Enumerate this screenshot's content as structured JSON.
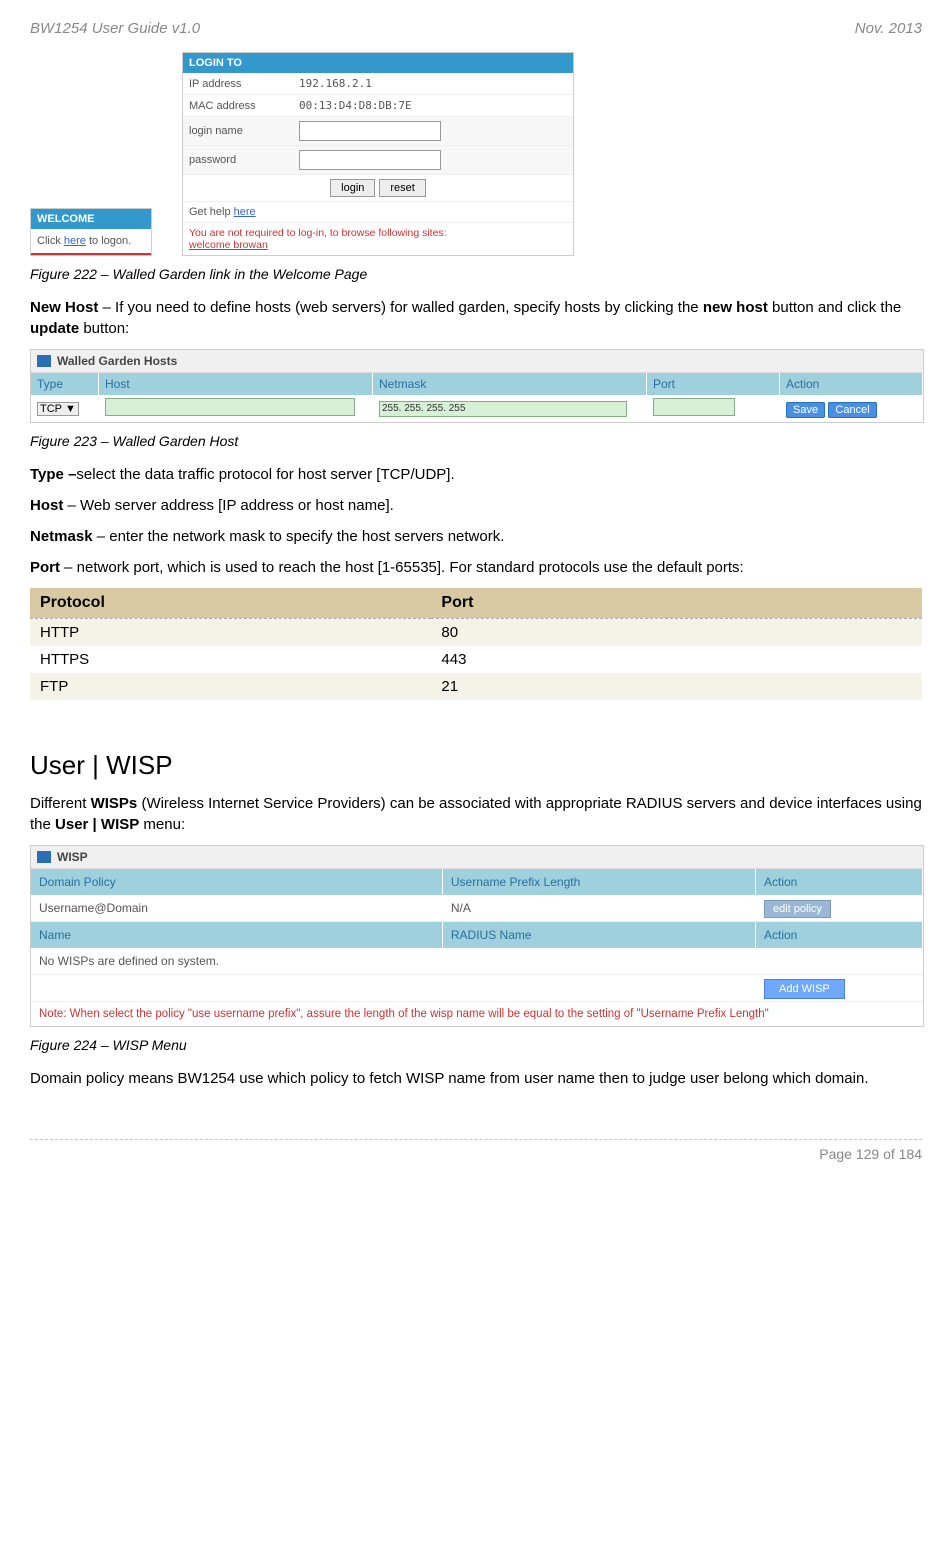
{
  "header": {
    "left": "BW1254 User Guide v1.0",
    "right": "Nov.  2013"
  },
  "welcome_panel": {
    "title": "WELCOME",
    "body_prefix": "Click ",
    "body_link": "here",
    "body_suffix": " to logon."
  },
  "login_panel": {
    "title": "LOGIN TO",
    "ip_label": "IP address",
    "ip_value": "192.168.2.1",
    "mac_label": "MAC address",
    "mac_value": "00:13:D4:D8:DB:7E",
    "login_name_label": "login name",
    "password_label": "password",
    "login_btn": "login",
    "reset_btn": "reset",
    "help_prefix": "Get help ",
    "help_link": "here",
    "note_text": "You are not required to log-in, to browse following sites:",
    "note_link": "welcome browan"
  },
  "fig222": "Figure 222 – Walled Garden link in the Welcome Page",
  "para_newhost_1": "New Host",
  "para_newhost_2": " – If you need to define hosts (web servers) for walled garden, specify hosts by clicking the ",
  "para_newhost_3": "new host",
  "para_newhost_4": " button and click the ",
  "para_newhost_5": "update",
  "para_newhost_6": " button:",
  "wg_panel": {
    "title": "Walled Garden Hosts",
    "cols": {
      "type": "Type",
      "host": "Host",
      "netmask": "Netmask",
      "port": "Port",
      "action": "Action"
    },
    "row": {
      "type": "TCP",
      "netmask_value": "255. 255. 255. 255",
      "save": "Save",
      "cancel": "Cancel"
    }
  },
  "fig223": "Figure 223 – Walled Garden Host",
  "para_type_1": "Type –",
  "para_type_2": "select the data traffic protocol for host server [TCP/UDP].",
  "para_host_1": "Host",
  "para_host_2": " – Web server address [IP address or host name].",
  "para_netmask_1": "Netmask",
  "para_netmask_2": " – enter the network mask to specify the host servers network.",
  "para_port_1": "Port",
  "para_port_2": " – network port, which is used to reach the host [1-65535]. For standard protocols use the default ports:",
  "proto_table": {
    "header": {
      "col1": "Protocol",
      "col2": "Port"
    },
    "rows": [
      {
        "col1": "HTTP",
        "col2": "80"
      },
      {
        "col1": "HTTPS",
        "col2": "443"
      },
      {
        "col1": "FTP",
        "col2": "21"
      }
    ]
  },
  "section_title": "User | WISP",
  "wisp_para_1": "Different ",
  "wisp_para_2": "WISPs",
  "wisp_para_3": " (Wireless Internet Service Providers) can be associated with appropriate RADIUS servers and device interfaces using the ",
  "wisp_para_4": "User | WISP",
  "wisp_para_5": " menu:",
  "wisp_panel": {
    "title": "WISP",
    "row1": {
      "c1": "Domain Policy",
      "c2": "Username Prefix Length",
      "c3": "Action"
    },
    "row2": {
      "c1": "Username@Domain",
      "c2": "N/A",
      "btn": "edit  policy"
    },
    "row3": {
      "c1": "Name",
      "c2": "RADIUS Name",
      "c3": "Action"
    },
    "row4": "No WISPs are defined on system.",
    "add_btn": "Add WISP",
    "note": "Note: When select the policy \"use username prefix\", assure the length of the wisp name will be equal to the setting of \"Username Prefix Length\""
  },
  "fig224": "Figure 224 – WISP Menu",
  "domain_policy_para": "Domain policy means BW1254 use which policy to fetch WISP name from user name then to judge user belong which domain.",
  "footer": "Page 129 of 184"
}
